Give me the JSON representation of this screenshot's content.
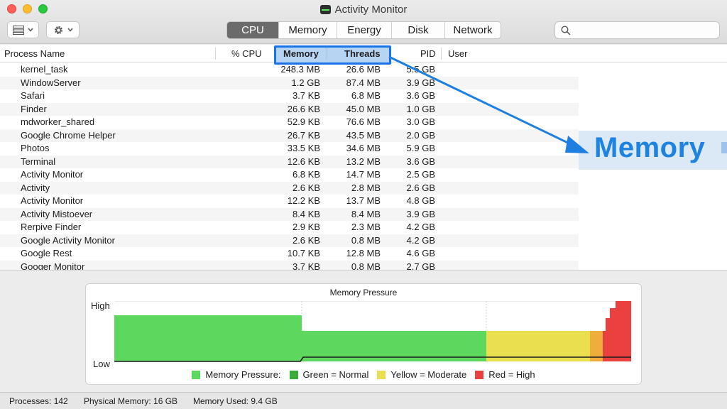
{
  "window": {
    "title": "Activity Monitor"
  },
  "toolbar": {
    "tabs": [
      "CPU",
      "Memory",
      "Energy",
      "Disk",
      "Network"
    ],
    "active_tab": "CPU",
    "search_placeholder": ""
  },
  "table": {
    "headers": {
      "name": "Process Name",
      "cpu": "% CPU",
      "memory": "Memory",
      "threads": "Threads",
      "pid": "PID",
      "user": "User"
    },
    "rows": [
      {
        "name": "kernel_task",
        "memory": "248.3 MB",
        "threads": "26.6 MB",
        "pid": "5.5 GB"
      },
      {
        "name": "WindowServer",
        "memory": "1.2 GB",
        "threads": "87.4 MB",
        "pid": "3.9 GB"
      },
      {
        "name": "Safari",
        "memory": "3.7 KB",
        "threads": "6.8 MB",
        "pid": "3.6 GB"
      },
      {
        "name": "Finder",
        "memory": "26.6 KB",
        "threads": "45.0 MB",
        "pid": "1.0 GB"
      },
      {
        "name": "mdworker_shared",
        "memory": "52.9 KB",
        "threads": "76.6 MB",
        "pid": "3.0 GB"
      },
      {
        "name": "Google Chrome Helper",
        "memory": "26.7 KB",
        "threads": "43.5 MB",
        "pid": "2.0 GB"
      },
      {
        "name": "Photos",
        "memory": "33.5 KB",
        "threads": "34.6 MB",
        "pid": "5.9 GB"
      },
      {
        "name": "Terminal",
        "memory": "12.6 KB",
        "threads": "13.2 MB",
        "pid": "3.6 GB"
      },
      {
        "name": "Activity Monitor",
        "memory": "6.8 KB",
        "threads": "14.7 MB",
        "pid": "2.5 GB"
      },
      {
        "name": "Activity",
        "memory": "2.6 KB",
        "threads": "2.8 MB",
        "pid": "2.6 GB"
      },
      {
        "name": "Activity Monitor",
        "memory": "12.2 KB",
        "threads": "13.7 MB",
        "pid": "4.8 GB"
      },
      {
        "name": "Activity Mistoever",
        "memory": "8.4 KB",
        "threads": "8.4 MB",
        "pid": "3.9 GB"
      },
      {
        "name": "Rerpive Finder",
        "memory": "2.9 KB",
        "threads": "2.3 MB",
        "pid": "4.2 GB"
      },
      {
        "name": "Google Activity Monitor",
        "memory": "2.6 KB",
        "threads": "0.8 MB",
        "pid": "4.2 GB"
      },
      {
        "name": "Google Rest",
        "memory": "10.7 KB",
        "threads": "12.8 MB",
        "pid": "4.6 GB"
      },
      {
        "name": "Googer Monitor",
        "memory": "3.7 KB",
        "threads": "0.8 MB",
        "pid": "2.7 GB"
      }
    ]
  },
  "callout": {
    "text": "Memory",
    "color": "#1e82e0"
  },
  "pressure": {
    "title": "Memory Pressure",
    "high_label": "High",
    "low_label": "Low",
    "legend": [
      {
        "label": "Memory Pressure:",
        "color": "#5dd75d"
      },
      {
        "label": "Green  = Normal",
        "color": "#3aaa3a"
      },
      {
        "label": "Yellow = Moderate",
        "color": "#e9df4f"
      },
      {
        "label": "Red = High",
        "color": "#ea4040"
      }
    ]
  },
  "status": {
    "processes": "Processes: 142",
    "physical": "Physical Memory: 16 GB",
    "used": "Memory Used: 9.4 GB"
  }
}
